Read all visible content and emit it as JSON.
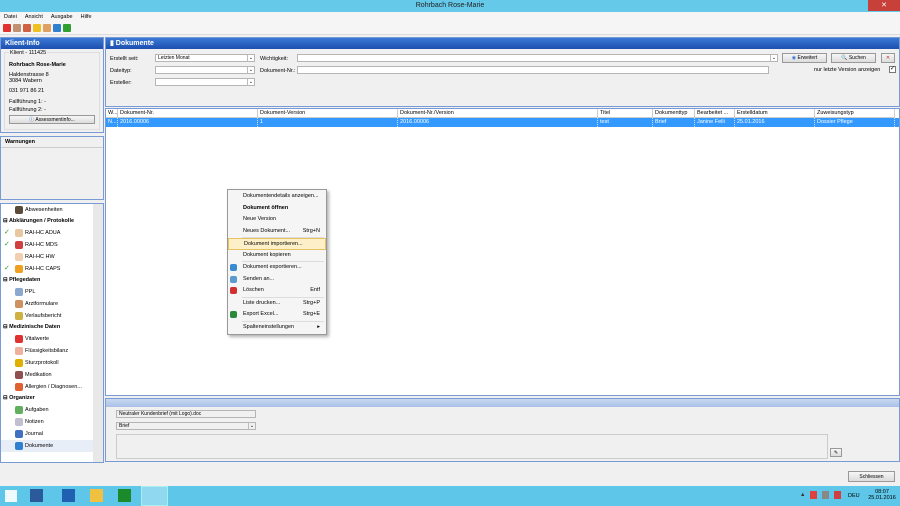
{
  "window": {
    "title": "Rohrbach Rose-Marie",
    "close": "✕"
  },
  "menu": [
    "Datei",
    "Ansicht",
    "Ausgabe",
    "Hilfe"
  ],
  "klient": {
    "header": "Klient-Info",
    "group": "Klient - 111425",
    "name": "Rohrbach Rose-Marie",
    "street": "Haldenstrasse 8",
    "city": "3084 Wabern",
    "phone": "031 971 86 21",
    "ff1": "Fallführung 1: -",
    "ff2": "Fallführung 2: -",
    "assess_btn": "Assessmentinfo..."
  },
  "warnungen": {
    "header": "Warnungen"
  },
  "nav": {
    "top": {
      "label": "Abwesenheiten"
    },
    "groups": [
      {
        "label": "Abklärungen / Protokolle",
        "items": [
          {
            "label": "RAI-HC ADUA",
            "checked": true,
            "color": "#e8c8a0"
          },
          {
            "label": "RAI-HC MDS",
            "checked": true,
            "color": "#d04040"
          },
          {
            "label": "RAI-HC HW",
            "checked": false,
            "color": "#f0d0b0"
          },
          {
            "label": "RAI-HC CAPS",
            "checked": true,
            "color": "#f0a020"
          }
        ]
      },
      {
        "label": "Pflegedaten",
        "items": [
          {
            "label": "PPL",
            "color": "#8aa8d0"
          },
          {
            "label": "Arztformulare",
            "color": "#d09060"
          },
          {
            "label": "Verlaufsbericht",
            "color": "#d0b040"
          }
        ]
      },
      {
        "label": "Medizinische Daten",
        "items": [
          {
            "label": "Vitalwerte",
            "color": "#e03030"
          },
          {
            "label": "Flüssigkeitsbilanz",
            "color": "#f0b0a0"
          },
          {
            "label": "Sturzprotokoll",
            "color": "#e0b000"
          },
          {
            "label": "Medikation",
            "color": "#905050"
          },
          {
            "label": "Allergien / Diagnosen...",
            "color": "#e06030"
          }
        ]
      },
      {
        "label": "Organizer",
        "items": [
          {
            "label": "Aufgaben",
            "color": "#60b060"
          },
          {
            "label": "Notizen",
            "color": "#c0c0d0"
          },
          {
            "label": "Journal",
            "color": "#4070c0"
          },
          {
            "label": "Dokumente",
            "color": "#3080d0",
            "selected": true
          }
        ]
      }
    ]
  },
  "dokumente": {
    "header": "Dokumente",
    "filters": {
      "erstellt_seit_label": "Erstellt seit:",
      "erstellt_seit_value": "Letzten Monat",
      "dateityp_label": "Dateityp:",
      "ersteller_label": "Ersteller:",
      "wichtigkeit_label": "Wichtigkeit:",
      "dokument_nr_label": "Dokument-Nr.:",
      "erweitert": "Erweitert",
      "suchen": "Suchen",
      "nur_letzte": "nur letzte Version anzeigen",
      "nur_letzte_checked": true
    },
    "columns": [
      "W...",
      "Dokument-Nr.",
      "Dokument-Version",
      "Dokument-Nr./Version",
      "Titel",
      "Dokumenttyp",
      "Bearbeitet ...",
      "Erstelldatum",
      "Zuweisungstyp"
    ],
    "rows": [
      [
        "N...",
        "2016.00006",
        "1",
        "2016.00006",
        "test",
        "Brief",
        "Janine Felli",
        "25.01.2016",
        "Dossier Pflege"
      ]
    ],
    "detail": {
      "template": "Neutraler Kundenbrief (mit Logo).doc",
      "type": "Brief"
    },
    "close_btn": "Schliessen"
  },
  "context_menu": [
    {
      "label": "Dokumentendetails anzeigen..."
    },
    {
      "label": "Dokument öffnen",
      "bold": true
    },
    {
      "label": "Neue Version"
    },
    {
      "label": "Neues Dokument...",
      "shortcut": "Strg+N"
    },
    {
      "sep": true
    },
    {
      "label": "Dokument importieren...",
      "highlight": true
    },
    {
      "label": "Dokument kopieren"
    },
    {
      "sep": true
    },
    {
      "label": "Dokument exportieren...",
      "icon": "#3a8ad0"
    },
    {
      "label": "Senden an...",
      "icon": "#5a9ad0"
    },
    {
      "label": "Löschen",
      "shortcut": "Entf",
      "icon": "#d03030"
    },
    {
      "sep": true
    },
    {
      "label": "Liste drucken...",
      "shortcut": "Strg+P"
    },
    {
      "label": "Export Excel...",
      "shortcut": "Strg+E",
      "icon": "#2a8a3a"
    },
    {
      "sep": true
    },
    {
      "label": "Spalteneinstellungen",
      "shortcut": "▸"
    }
  ],
  "tray": {
    "lang": "DEU",
    "time": "08:07",
    "date": "25.01.2016"
  }
}
